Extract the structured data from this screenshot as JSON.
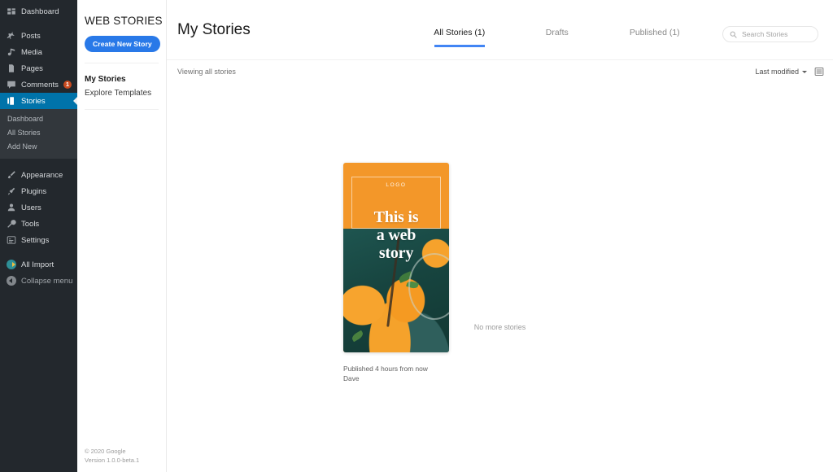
{
  "wp_sidebar": {
    "items": [
      {
        "label": "Dashboard",
        "icon": "dashboard-icon"
      },
      {
        "label": "Posts",
        "icon": "pin-icon"
      },
      {
        "label": "Media",
        "icon": "media-icon"
      },
      {
        "label": "Pages",
        "icon": "page-icon"
      },
      {
        "label": "Comments",
        "icon": "comment-icon",
        "badge": "1"
      },
      {
        "label": "Stories",
        "icon": "stories-icon",
        "active": true
      }
    ],
    "submenu": [
      {
        "label": "Dashboard"
      },
      {
        "label": "All Stories"
      },
      {
        "label": "Add New"
      }
    ],
    "items2": [
      {
        "label": "Appearance",
        "icon": "brush-icon"
      },
      {
        "label": "Plugins",
        "icon": "plug-icon"
      },
      {
        "label": "Users",
        "icon": "users-icon"
      },
      {
        "label": "Tools",
        "icon": "wrench-icon"
      },
      {
        "label": "Settings",
        "icon": "settings-icon"
      }
    ],
    "all_import": {
      "label": "All Import",
      "icon": "all-import-icon"
    },
    "collapse": {
      "label": "Collapse menu",
      "icon": "collapse-arrow-icon"
    }
  },
  "ws_nav": {
    "title": "WEB STORIES",
    "create_button": "Create New Story",
    "links": [
      {
        "label": "My Stories",
        "current": true
      },
      {
        "label": "Explore Templates",
        "current": false
      }
    ],
    "footer_copyright": "© 2020 Google",
    "footer_version": "Version 1.0.0-beta.1"
  },
  "main": {
    "page_title": "My Stories",
    "tabs": [
      {
        "label": "All Stories (1)",
        "active": true
      },
      {
        "label": "Drafts",
        "active": false
      },
      {
        "label": "Published (1)",
        "active": false
      }
    ],
    "search": {
      "placeholder": "Search Stories",
      "value": "",
      "icon": "search-icon"
    },
    "subbar": {
      "viewing_text": "Viewing all stories",
      "sort_label": "Last modified",
      "view_toggle_icon": "list-view-icon"
    },
    "story": {
      "logo_text": "LOGO",
      "headline_line1": "This is",
      "headline_line2": "a web",
      "headline_line3": "story",
      "status": "Published 4 hours from now",
      "author": "Dave"
    },
    "no_more_text": "No more stories"
  },
  "colors": {
    "wp_sidebar_bg": "#23282d",
    "wp_submenu_bg": "#32373c",
    "wp_active_blue": "#0073aa",
    "accent_blue": "#2979e8",
    "tab_underline": "#4285f4",
    "badge_orange": "#ca4a1f",
    "card_orange": "#f39729"
  }
}
